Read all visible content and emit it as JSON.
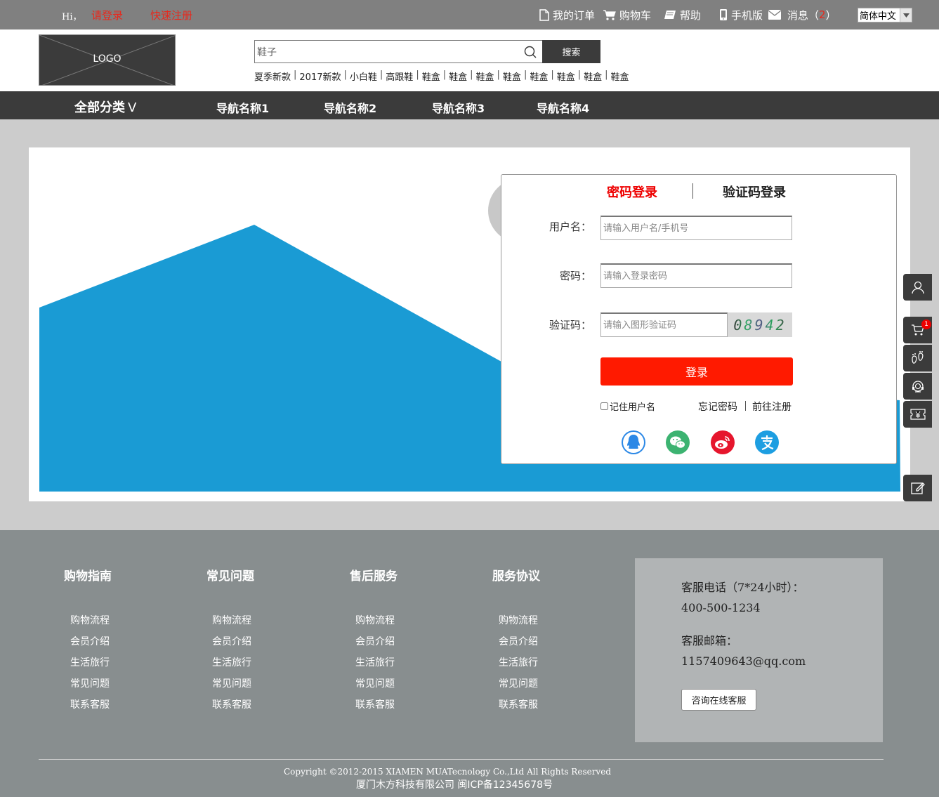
{
  "topbar": {
    "greeting": "Hi，",
    "login_link": "请登录",
    "register_link": "快速注册",
    "my_orders": "我的订单",
    "cart": "购物车",
    "help": "帮助",
    "mobile": "手机版",
    "messages": "消息（",
    "messages_count": "2",
    "messages_close": "）",
    "language": "简体中文"
  },
  "header": {
    "logo_text": "LOGO",
    "search_value": "鞋子",
    "search_button": "搜索",
    "hot_words": [
      "夏季新款",
      "2017新款",
      "小白鞋",
      "高跟鞋",
      "鞋盒",
      "鞋盒",
      "鞋盒",
      "鞋盒",
      "鞋盒",
      "鞋盒",
      "鞋盒",
      "鞋盒"
    ]
  },
  "nav": {
    "all_categories": "全部分类",
    "all_arrow": "V",
    "items": [
      "导航名称1",
      "导航名称2",
      "导航名称3",
      "导航名称4"
    ]
  },
  "login": {
    "tab_password": "密码登录",
    "tab_code": "验证码登录",
    "username_label": "用户名：",
    "username_placeholder": "请输入用户名/手机号",
    "password_label": "密码：",
    "password_placeholder": "请输入登录密码",
    "captcha_label": "验证码：",
    "captcha_placeholder": "请输入图形验证码",
    "captcha_text": "08942",
    "login_button": "登录",
    "remember": "记住用户名",
    "forgot": "忘记密码",
    "go_register": "前往注册"
  },
  "sidebar": {
    "cart_badge": "1"
  },
  "footer": {
    "columns": [
      {
        "title": "购物指南",
        "links": [
          "购物流程",
          "会员介绍",
          "生活旅行",
          "常见问题",
          "联系客服"
        ]
      },
      {
        "title": "常见问题",
        "links": [
          "购物流程",
          "会员介绍",
          "生活旅行",
          "常见问题",
          "联系客服"
        ]
      },
      {
        "title": "售后服务",
        "links": [
          "购物流程",
          "会员介绍",
          "生活旅行",
          "常见问题",
          "联系客服"
        ]
      },
      {
        "title": "服务协议",
        "links": [
          "购物流程",
          "会员介绍",
          "生活旅行",
          "常见问题",
          "联系客服"
        ]
      }
    ],
    "phone_label": "客服电话（7*24小时）：",
    "phone": "400-500-1234",
    "email_label": "客服邮箱：",
    "email": "1157409643@qq.com",
    "online_button": "咨询在线客服",
    "copyright": "Copyright ©2012-2015 XIAMEN MUATecnology Co.,Ltd All Rights Reserved",
    "icp": "厦门木方科技有限公司 闽ICP备12345678号"
  },
  "colors": {
    "accent_red": "#ff1a00",
    "banner_blue": "#1a9bd4",
    "dark_bar": "#3b3b3b"
  }
}
